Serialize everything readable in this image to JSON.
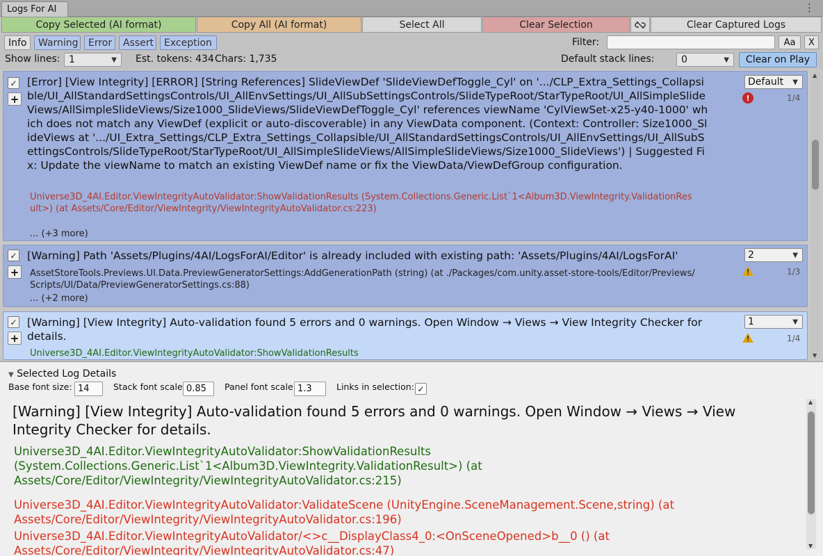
{
  "window": {
    "tab_title": "Logs For AI",
    "menu_glyph": "⋮"
  },
  "toolbar": {
    "copy_selected": "Copy Selected (AI format)",
    "copy_all": "Copy All (AI format)",
    "select_all": "Select All",
    "clear_selection": "Clear Selection",
    "clear_captured": "Clear Captured Logs"
  },
  "filters": {
    "info": "Info",
    "warning": "Warning",
    "error": "Error",
    "assert": "Assert",
    "exception": "Exception",
    "filter_label": "Filter:",
    "filter_value": "",
    "match_case": "Aa",
    "clear": "X"
  },
  "stats": {
    "show_lines_label": "Show lines:",
    "show_lines_value": "1",
    "est_tokens": "Est. tokens: 434",
    "chars": "Chars: 1,735",
    "default_stack_label": "Default stack lines:",
    "default_stack_value": "0",
    "clear_on_play": "Clear on Play"
  },
  "logs": [
    {
      "type": "error",
      "checked": true,
      "message": "[Error] [View Integrity] [ERROR] [String References] SlideViewDef 'SlideViewDefToggle_Cyl' on '.../CLP_Extra_Settings_Collapsible/UI_AllStandardSettingsControls/UI_AllEnvSettings/UI_AllSubSettingsControls/SlideTypeRoot/StarTypeRoot/UI_AllSimpleSlideViews/AllSimpleSlideViews/Size1000_SlideViews/SlideViewDefToggle_Cyl' references viewName 'CylViewSet-x25-y40-1000' which does not match any ViewDef (explicit or auto-discoverable) in any ViewData component. (Context: Controller: Size1000_SlideViews at '.../UI_Extra_Settings/CLP_Extra_Settings_Collapsible/UI_AllStandardSettingsControls/UI_AllEnvSettings/UI_AllSubSettingsControls/SlideTypeRoot/StarTypeRoot/UI_AllSimpleSlideViews/AllSimpleSlideViews/Size1000_SlideViews') | Suggested Fix: Update the viewName to match an existing ViewDef name or fix the ViewData/ViewDefGroup configuration.",
      "stack": "Universe3D_4AI.Editor.ViewIntegrityAutoValidator:ShowValidationResults (System.Collections.Generic.List`1<Album3D.ViewIntegrity.ValidationResult>) (at Assets/Core/Editor/ViewIntegrity/ViewIntegrityAutoValidator.cs:223)",
      "more": "... (+3 more)",
      "dropdown": "Default",
      "counter": "1/4"
    },
    {
      "type": "warning",
      "checked": true,
      "message": "[Warning] Path 'Assets/Plugins/4AI/LogsForAI/Editor' is already included with existing path: 'Assets/Plugins/4AI/LogsForAI'",
      "stack": "AssetStoreTools.Previews.UI.Data.PreviewGeneratorSettings:AddGenerationPath (string) (at ./Packages/com.unity.asset-store-tools/Editor/Previews/Scripts/UI/Data/PreviewGeneratorSettings.cs:88)",
      "more": "... (+2 more)",
      "dropdown": "2",
      "counter": "1/3"
    },
    {
      "type": "warning",
      "checked": true,
      "message": "[Warning] [View Integrity] Auto-validation found 5 errors and 0 warnings. Open Window → Views → View Integrity Checker for details.",
      "stack": "Universe3D_4AI.Editor.ViewIntegrityAutoValidator:ShowValidationResults",
      "dropdown": "1",
      "counter": "1/4"
    }
  ],
  "details": {
    "header": "Selected Log Details",
    "base_font_label": "Base font size:",
    "base_font_value": "14",
    "stack_scale_label": "Stack font scale",
    "stack_scale_value": "0.85",
    "panel_scale_label": "Panel font scale:",
    "panel_scale_value": "1.3",
    "links_label": "Links in selection:",
    "links_checked": true,
    "message": "[Warning] [View Integrity] Auto-validation found 5 errors and 0 warnings. Open Window → Views → View Integrity Checker for details.",
    "lines": [
      {
        "text": "Universe3D_4AI.Editor.ViewIntegrityAutoValidator:ShowValidationResults (System.Collections.Generic.List`1<Album3D.ViewIntegrity.ValidationResult>) (at Assets/Core/Editor/ViewIntegrity/ViewIntegrityAutoValidator.cs:215)",
        "color": "#1f6b12"
      },
      {
        "text": "Universe3D_4AI.Editor.ViewIntegrityAutoValidator:ValidateScene (UnityEngine.SceneManagement.Scene,string) (at Assets/Core/Editor/ViewIntegrity/ViewIntegrityAutoValidator.cs:196)",
        "color": "#d9331f"
      },
      {
        "text": "Universe3D_4AI.Editor.ViewIntegrityAutoValidator/<>c__DisplayClass4_0:<OnSceneOpened>b__0 () (at Assets/Core/Editor/ViewIntegrity/ViewIntegrityAutoValidator.cs:47)",
        "color": "#d9331f"
      }
    ]
  },
  "colors": {
    "stack_error": "#b33a2e",
    "stack_warning": "#222222",
    "stack_selected": "#1f6b12",
    "error_icon": "#c62828",
    "warning_icon": "#e0a30b"
  }
}
